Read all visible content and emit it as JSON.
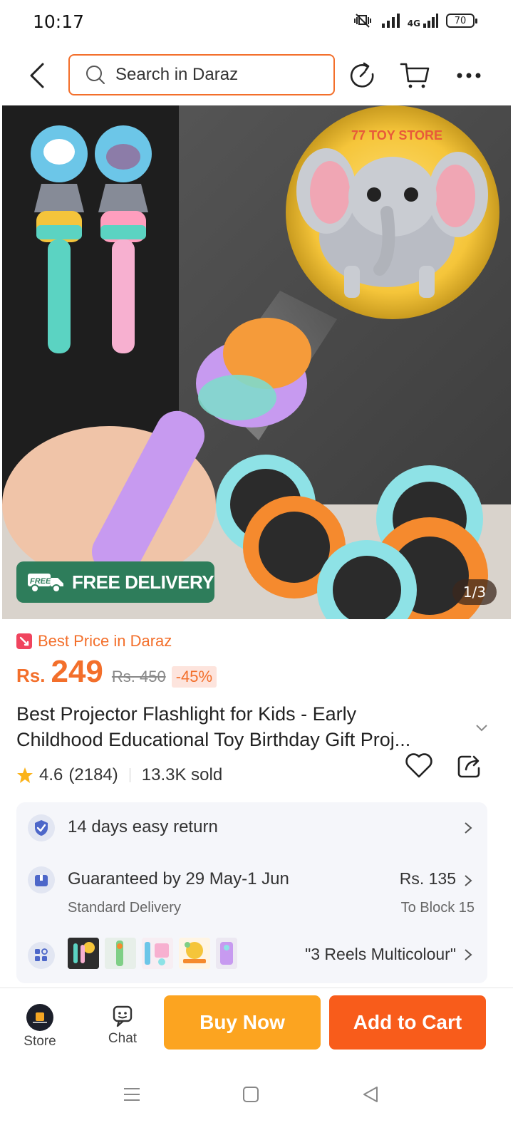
{
  "status_bar": {
    "time": "10:17",
    "network": "4G",
    "battery": "70"
  },
  "topnav": {
    "search_placeholder": "Search in Daraz"
  },
  "hero": {
    "free_delivery": "FREE DELIVERY",
    "free_tag": "FREE",
    "counter": "1/3",
    "watermark": "77 TOY STORE"
  },
  "price": {
    "best_price_label": "Best Price in Daraz",
    "currency": "Rs.",
    "current": "249",
    "original": "Rs. 450",
    "discount": "-45%"
  },
  "product": {
    "title_line1": "Best Projector Flashlight for Kids - Early",
    "title_line2": "Childhood Educational Toy Birthday Gift Proj..."
  },
  "rating": {
    "score": "4.6",
    "count": "(2184)",
    "sold": "13.3K sold"
  },
  "info": {
    "return_text": "14 days easy return",
    "delivery_title": "Guaranteed by 29 May-1 Jun",
    "delivery_sub": "Standard Delivery",
    "delivery_price": "Rs. 135",
    "delivery_dest": "To Block 15",
    "variant_text": "\"3 Reels Multicolour\""
  },
  "bottom_bar": {
    "store_label": "Store",
    "chat_label": "Chat",
    "buy_now": "Buy Now",
    "add_to_cart": "Add to Cart"
  },
  "colors": {
    "brand_orange": "#f36f2b",
    "buy_now_bg": "#fca420",
    "add_cart_bg": "#f85c1b",
    "free_badge_bg": "#2e7d5b"
  }
}
